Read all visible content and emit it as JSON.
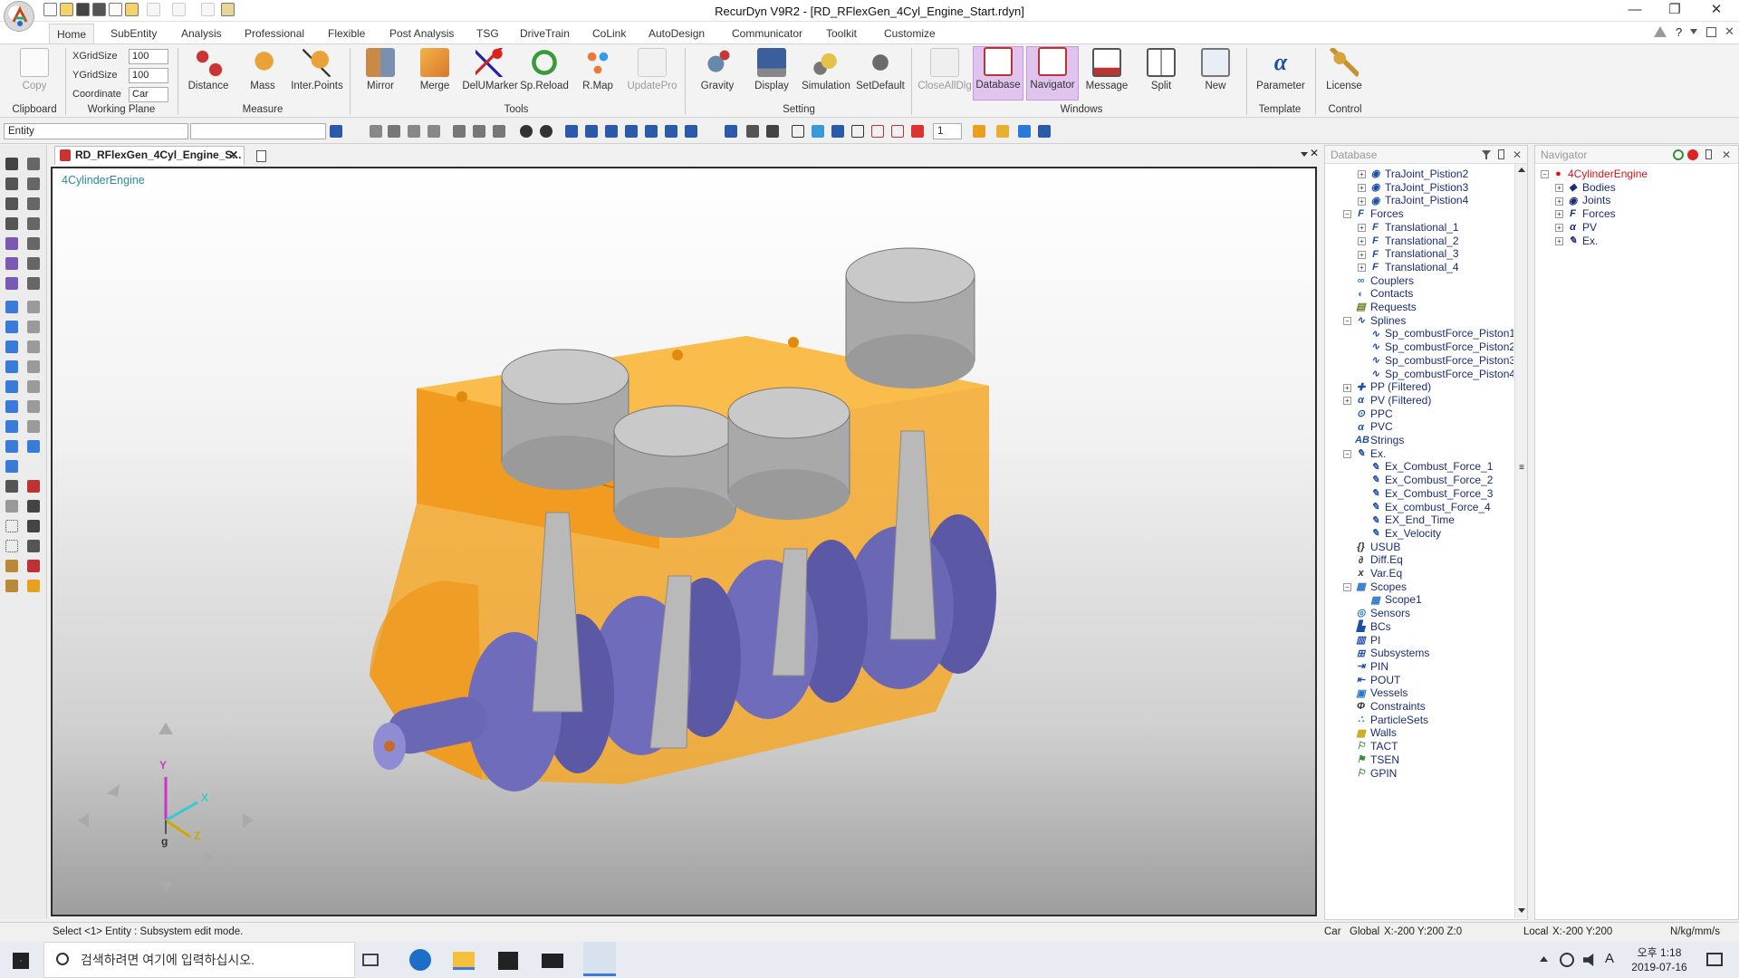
{
  "window": {
    "title": "RecurDyn V9R2  - [RD_RFlexGen_4Cyl_Engine_Start.rdyn]",
    "controls": [
      "—",
      "❐",
      "?",
      "✕"
    ]
  },
  "ribbon_tabs": [
    "Home",
    "SubEntity",
    "Analysis",
    "Professional",
    "Flexible",
    "Post Analysis",
    "TSG",
    "DriveTrain",
    "CoLink",
    "AutoDesign",
    "Communicator",
    "Toolkit",
    "Customize"
  ],
  "ribbon": {
    "copy": "Copy",
    "xgrid_label": "XGridSize",
    "xgrid_value": "100",
    "ygrid_label": "YGridSize",
    "ygrid_value": "100",
    "coord_label": "Coordinate",
    "coord_value": "Car",
    "groups": {
      "clipboard": "Clipboard",
      "working_plane": "Working Plane",
      "measure": "Measure",
      "tools": "Tools",
      "setting": "Setting",
      "windows": "Windows",
      "template": "Template",
      "control": "Control"
    },
    "buttons": {
      "distance": "Distance",
      "mass": "Mass",
      "inter_points": "Inter.Points",
      "mirror": "Mirror",
      "merge": "Merge",
      "delumarker": "DelUMarker",
      "spreload": "Sp.Reload",
      "rmap": "R.Map",
      "updatepro": "UpdatePro",
      "gravity": "Gravity",
      "display": "Display",
      "simulation": "Simulation",
      "setdefault": "SetDefault",
      "closealldlg": "CloseAllDlg",
      "database": "Database",
      "navigator": "Navigator",
      "message": "Message",
      "split": "Split",
      "new": "New",
      "parameter": "Parameter",
      "license": "License"
    }
  },
  "toolbar": {
    "entity_value": "Entity",
    "spin_value": "1"
  },
  "document": {
    "tab_label": "RD_RFlexGen_4Cyl_Engine_S...",
    "viewport_label": "4CylinderEngine",
    "axes": {
      "x": "X",
      "y": "Y",
      "z": "Z",
      "g": "g"
    }
  },
  "database": {
    "header": "Database",
    "items": [
      {
        "label": "TraJoint_Pistion2",
        "level": 2,
        "exp": "+",
        "icon": "joint-icon",
        "color": "#1e4fa8"
      },
      {
        "label": "TraJoint_Pistion3",
        "level": 2,
        "exp": "+",
        "icon": "joint-icon",
        "color": "#1e4fa8"
      },
      {
        "label": "TraJoint_Pistion4",
        "level": 2,
        "exp": "+",
        "icon": "joint-icon",
        "color": "#1e4fa8"
      },
      {
        "label": "Forces",
        "level": 1,
        "exp": "−",
        "icon": "force-icon",
        "color": "#1e4fa8"
      },
      {
        "label": "Translational_1",
        "level": 2,
        "exp": "+",
        "icon": "force-icon",
        "color": "#1e4fa8"
      },
      {
        "label": "Translational_2",
        "level": 2,
        "exp": "+",
        "icon": "force-icon",
        "color": "#1e4fa8"
      },
      {
        "label": "Translational_3",
        "level": 2,
        "exp": "+",
        "icon": "force-icon",
        "color": "#1e4fa8"
      },
      {
        "label": "Translational_4",
        "level": 2,
        "exp": "+",
        "icon": "force-icon",
        "color": "#1e4fa8"
      },
      {
        "label": "Couplers",
        "level": 1,
        "exp": "",
        "icon": "coupler-icon",
        "color": "#2a79c9"
      },
      {
        "label": "Contacts",
        "level": 1,
        "exp": "",
        "icon": "contact-icon",
        "color": "#3d86c6"
      },
      {
        "label": "Requests",
        "level": 1,
        "exp": "",
        "icon": "request-icon",
        "color": "#6a7a1c"
      },
      {
        "label": "Splines",
        "level": 1,
        "exp": "−",
        "icon": "spline-icon",
        "color": "#1e4fa8"
      },
      {
        "label": "Sp_combustForce_Piston1",
        "level": 2,
        "exp": "",
        "icon": "spline-icon",
        "color": "#1e4fa8"
      },
      {
        "label": "Sp_combustForce_Piston2",
        "level": 2,
        "exp": "",
        "icon": "spline-icon",
        "color": "#1e4fa8"
      },
      {
        "label": "Sp_combustForce_Piston3",
        "level": 2,
        "exp": "",
        "icon": "spline-icon",
        "color": "#1e4fa8"
      },
      {
        "label": "Sp_combustForce_Piston4",
        "level": 2,
        "exp": "",
        "icon": "spline-icon",
        "color": "#1e4fa8"
      },
      {
        "label": "PP (Filtered)",
        "level": 1,
        "exp": "+",
        "icon": "pp-icon",
        "color": "#1e4fa8"
      },
      {
        "label": "PV (Filtered)",
        "level": 1,
        "exp": "+",
        "icon": "pv-icon",
        "color": "#1e4fa8"
      },
      {
        "label": "PPC",
        "level": 1,
        "exp": "",
        "icon": "ppc-icon",
        "color": "#1e4fa8"
      },
      {
        "label": "PVC",
        "level": 1,
        "exp": "",
        "icon": "pvc-icon",
        "color": "#1e4fa8"
      },
      {
        "label": "Strings",
        "level": 1,
        "exp": "",
        "icon": "strings-icon",
        "color": "#1e4fa8"
      },
      {
        "label": "Ex.",
        "level": 1,
        "exp": "−",
        "icon": "expression-icon",
        "color": "#1e4fa8"
      },
      {
        "label": "Ex_Combust_Force_1",
        "level": 2,
        "exp": "",
        "icon": "expression-icon",
        "color": "#1e4fa8"
      },
      {
        "label": "Ex_Combust_Force_2",
        "level": 2,
        "exp": "",
        "icon": "expression-icon",
        "color": "#1e4fa8"
      },
      {
        "label": "Ex_Combust_Force_3",
        "level": 2,
        "exp": "",
        "icon": "expression-icon",
        "color": "#1e4fa8"
      },
      {
        "label": "Ex_combust_Force_4",
        "level": 2,
        "exp": "",
        "icon": "expression-icon",
        "color": "#1e4fa8"
      },
      {
        "label": "EX_End_Time",
        "level": 2,
        "exp": "",
        "icon": "expression-icon",
        "color": "#1e4fa8"
      },
      {
        "label": "Ex_Velocity",
        "level": 2,
        "exp": "",
        "icon": "expression-icon",
        "color": "#1e4fa8"
      },
      {
        "label": "USUB",
        "level": 1,
        "exp": "",
        "icon": "usub-icon",
        "color": "#333"
      },
      {
        "label": "Diff.Eq",
        "level": 1,
        "exp": "",
        "icon": "diffeq-icon",
        "color": "#333"
      },
      {
        "label": "Var.Eq",
        "level": 1,
        "exp": "",
        "icon": "vareq-icon",
        "color": "#333"
      },
      {
        "label": "Scopes",
        "level": 1,
        "exp": "−",
        "icon": "scope-icon",
        "color": "#2a79c9"
      },
      {
        "label": "Scope1",
        "level": 2,
        "exp": "",
        "icon": "scope-icon",
        "color": "#2a79c9"
      },
      {
        "label": "Sensors",
        "level": 1,
        "exp": "",
        "icon": "sensor-icon",
        "color": "#2a79c9"
      },
      {
        "label": "BCs",
        "level": 1,
        "exp": "",
        "icon": "bc-icon",
        "color": "#1e4fa8"
      },
      {
        "label": "PI",
        "level": 1,
        "exp": "",
        "icon": "pi-icon",
        "color": "#1e4fa8"
      },
      {
        "label": "Subsystems",
        "level": 1,
        "exp": "",
        "icon": "subsystem-icon",
        "color": "#1e4fa8"
      },
      {
        "label": "PIN",
        "level": 1,
        "exp": "",
        "icon": "pin-icon",
        "color": "#1e4fa8"
      },
      {
        "label": "POUT",
        "level": 1,
        "exp": "",
        "icon": "pout-icon",
        "color": "#1e4fa8"
      },
      {
        "label": "Vessels",
        "level": 1,
        "exp": "",
        "icon": "vessel-icon",
        "color": "#2a79c9"
      },
      {
        "label": "Constraints",
        "level": 1,
        "exp": "",
        "icon": "constraint-icon",
        "color": "#333"
      },
      {
        "label": "ParticleSets",
        "level": 1,
        "exp": "",
        "icon": "particle-icon",
        "color": "#2a79c9"
      },
      {
        "label": "Walls",
        "level": 1,
        "exp": "",
        "icon": "wall-icon",
        "color": "#c7a71a"
      },
      {
        "label": "TACT",
        "level": 1,
        "exp": "",
        "icon": "tact-icon",
        "color": "#3a8f3a"
      },
      {
        "label": "TSEN",
        "level": 1,
        "exp": "",
        "icon": "tsen-icon",
        "color": "#3a8f3a"
      },
      {
        "label": "GPIN",
        "level": 1,
        "exp": "",
        "icon": "gpin-icon",
        "color": "#3a8f3a"
      }
    ]
  },
  "navigator": {
    "header": "Navigator",
    "items": [
      {
        "label": "4CylinderEngine",
        "level": 0,
        "exp": "−",
        "icon": "model-icon",
        "color": "#d0151b"
      },
      {
        "label": "Bodies",
        "level": 1,
        "exp": "+",
        "icon": "body-icon",
        "color": "#1a2d74"
      },
      {
        "label": "Joints",
        "level": 1,
        "exp": "+",
        "icon": "joint-icon",
        "color": "#1a2d74"
      },
      {
        "label": "Forces",
        "level": 1,
        "exp": "+",
        "icon": "force-icon",
        "color": "#1a2d74"
      },
      {
        "label": "PV",
        "level": 1,
        "exp": "+",
        "icon": "pv-icon",
        "color": "#1a2d74"
      },
      {
        "label": "Ex.",
        "level": 1,
        "exp": "+",
        "icon": "expression-icon",
        "color": "#1a2d74"
      }
    ]
  },
  "status": {
    "message": "Select <1> Entity : Subsystem edit mode.",
    "car": "Car",
    "global": "Global",
    "global_coords": "X:-200 Y:200 Z:0",
    "local": "Local",
    "local_coords": "X:-200 Y:200",
    "units": "N/kg/mm/s"
  },
  "taskbar": {
    "search_placeholder": "검색하려면 여기에 입력하십시오.",
    "time": "오후 1:18",
    "date": "2019-07-16",
    "ime": "A"
  },
  "colors": {
    "block": "#f5a623",
    "crank": "#6a67b5",
    "accent_selected": "#e0c4ef"
  }
}
